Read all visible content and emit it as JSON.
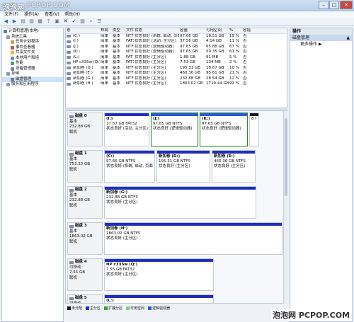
{
  "title": {
    "logo": "泡泡网",
    "site": "PCPOP.COM"
  },
  "menubar": [
    "文件(F)",
    "操作(A)",
    "查看(V)",
    "帮助(H)"
  ],
  "tree": [
    {
      "label": "计算机管理(本地)",
      "indent": 0
    },
    {
      "label": "系统工具",
      "indent": 1
    },
    {
      "label": "任务计划程序",
      "indent": 2
    },
    {
      "label": "事件查看器",
      "indent": 2
    },
    {
      "label": "共享文件夹",
      "indent": 2
    },
    {
      "label": "本地用户和组",
      "indent": 2
    },
    {
      "label": "性能",
      "indent": 2
    },
    {
      "label": "设备管理器",
      "indent": 2
    },
    {
      "label": "存储",
      "indent": 1
    },
    {
      "label": "磁盘管理",
      "indent": 2,
      "selected": true
    },
    {
      "label": "服务和应用程序",
      "indent": 1
    }
  ],
  "volumes": {
    "headers": [
      "卷",
      "布局",
      "类型",
      "文件",
      "状态",
      "容量",
      "可用空间",
      "%",
      "容错"
    ],
    "rows": [
      [
        "(C:)",
        "简单",
        "基本",
        "NTFS",
        "状态良好 (系统, 启动, 页面文件...",
        "97.66 GB",
        "18.51 GB",
        "19 %",
        "否"
      ],
      [
        "(I:)",
        "简单",
        "基本",
        "FAT32",
        "状态良好 (活动, 主分区)",
        "37.56 GB",
        "4.14 GB",
        "11 %",
        "否"
      ],
      [
        "(J:)",
        "简单",
        "基本",
        "NTFS",
        "状态良好 (逻辑驱动器)",
        "97.65 GB",
        "65.88 GB",
        "67 %",
        "否"
      ],
      [
        "(K:)",
        "简单",
        "基本",
        "NTFS",
        "状态良好 (逻辑驱动器)",
        "97.65 GB",
        "59.35 GB",
        "61 %",
        "否"
      ],
      [
        "(L:)",
        "简单",
        "基本",
        "FAT",
        "状态良好 (主分区)",
        "1.88 GB",
        "91 MB",
        "5 %",
        "否"
      ],
      [
        "HP c335w (Q:)",
        "简单",
        "基本",
        "FAT32",
        "状态良好 (主分区)",
        "7.53 GB",
        "134 MB",
        "2 %",
        "否"
      ],
      [
        "新加卷 (D:)",
        "简单",
        "基本",
        "NTFS",
        "状态良好 (主分区)",
        "195.31 GB",
        "18.67 GB",
        "10 %",
        "否"
      ],
      [
        "新加卷 (E:)",
        "简单",
        "基本",
        "NTFS",
        "状态良好 (主分区)",
        "460.36 GB",
        "95.61 GB",
        "21 %",
        "否"
      ],
      [
        "新加卷 (G:)",
        "简单",
        "基本",
        "NTFS",
        "状态良好 (主分区)",
        "232.88 GB",
        "28.54 GB",
        "12 %",
        "否"
      ],
      [
        "新加卷 (H:)",
        "简单",
        "基本",
        "NTFS",
        "状态良好 (主分区)",
        "1863.02 GB",
        "1719.44 GB",
        "92 %",
        "否"
      ]
    ]
  },
  "disks": [
    {
      "name": "磁盘 0",
      "type": "基本",
      "size": "232.88 GB",
      "status": "联机",
      "parts": [
        {
          "title": "(I:)",
          "line1": "37.57 GB FAT32",
          "line2": "状态良好 (活动, 主分区)",
          "kind": "primary"
        },
        {
          "title": "(J:)",
          "line1": "97.65 GB NTFS",
          "line2": "状态良好 (逻辑驱动器)",
          "kind": "logical"
        },
        {
          "title": "(K:)",
          "line1": "97.65 GB NTFS",
          "line2": "状态良好 (逻辑驱动器)",
          "kind": "logical"
        },
        {
          "title": "",
          "line1": "8 I",
          "line2": "",
          "kind": "unalloc"
        }
      ]
    },
    {
      "name": "磁盘 1",
      "type": "基本",
      "size": "753.33 GB",
      "status": "联机",
      "parts": [
        {
          "title": "(C:)",
          "line1": "97.66 GB NTFS",
          "line2": "状态良好 (系统, 启动, 页面",
          "kind": "primary"
        },
        {
          "title": "新加卷 (D:)",
          "line1": "195.31 GB NTFS",
          "line2": "状态良好 (主分区)",
          "kind": "primary"
        },
        {
          "title": "新加卷 (E:)",
          "line1": "460.36 GB NTFS",
          "line2": "状态良好 (主分区)",
          "kind": "primary"
        }
      ]
    },
    {
      "name": "磁盘 2",
      "type": "基本",
      "size": "232.88 GB",
      "status": "联机",
      "parts": [
        {
          "title": "新加卷 (G:)",
          "line1": "232.88 GB NTFS",
          "line2": "状态良好 (主分区)",
          "kind": "primary"
        }
      ]
    },
    {
      "name": "磁盘 3",
      "type": "基本",
      "size": "1863.02 GB",
      "status": "联机",
      "parts": [
        {
          "title": "新加卷 (H:)",
          "line1": "1863.02 GB NTFS",
          "line2": "状态良好 (主分区)",
          "kind": "primary"
        }
      ]
    },
    {
      "name": "磁盘 4",
      "type": "可移动",
      "size": "7.55 GB",
      "status": "联机",
      "parts": [
        {
          "title": "HP c335w (Q:)",
          "line1": "7.55 GB FAT32",
          "line2": "状态良好 (主分区)",
          "kind": "primary"
        }
      ]
    },
    {
      "name": "磁盘 5",
      "type": "可移动",
      "size": "",
      "status": "",
      "parts": [
        {
          "title": "(L:)",
          "line1": "",
          "line2": "",
          "kind": "primary"
        }
      ]
    }
  ],
  "legend": [
    {
      "label": "未分配",
      "color": "#111111"
    },
    {
      "label": "主分区",
      "color": "#1f2fbf"
    },
    {
      "label": "扩展分区",
      "color": "#3aa03a"
    },
    {
      "label": "可用空间",
      "color": "#7ccf7c"
    },
    {
      "label": "逻辑驱动器",
      "color": "#2b5bd6"
    }
  ],
  "actions": {
    "header": "操作",
    "section": "磁盘管理",
    "more": "更多操作"
  },
  "watermark": "泡泡网 PCPOP.COM",
  "colors": {
    "primary": "#1f2fbf",
    "logical": "#2b5bd6",
    "unalloc": "#111111"
  }
}
